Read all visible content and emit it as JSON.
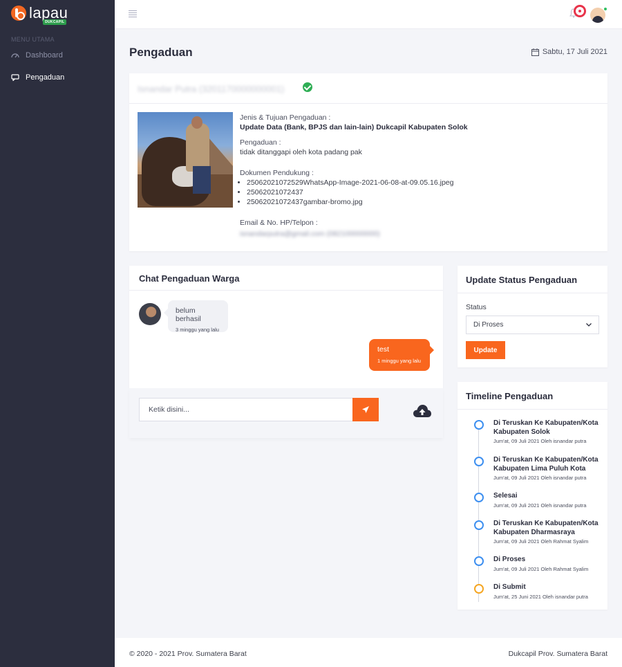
{
  "sidebar": {
    "logo_text": "lapau",
    "logo_tag": "DUKCAPIL",
    "menu_title": "MENU UTAMA",
    "items": [
      {
        "label": "Dashboard",
        "icon": "dashboard-icon"
      },
      {
        "label": "Pengaduan",
        "icon": "chat-icon"
      }
    ]
  },
  "header": {
    "title": "Pengaduan",
    "date": "Sabtu, 17 Juli 2021"
  },
  "complaint": {
    "reporter_blurred": "Isnandar Putra (3201170000000001)",
    "jenis_label": "Jenis & Tujuan Pengaduan :",
    "jenis_value": "Update Data (Bank, BPJS dan lain-lain) Dukcapil Kabupaten Solok",
    "pengaduan_label": "Pengaduan :",
    "pengaduan_value": "tidak ditanggapi oleh kota padang pak",
    "dokumen_label": "Dokumen Pendukung :",
    "documents": [
      "25062021072529WhatsApp-Image-2021-06-08-at-09.05.16.jpeg",
      "25062021072437",
      "25062021072437gambar-bromo.jpg"
    ],
    "contact_label": "Email & No. HP/Telpon :",
    "contact_value_blurred": "isnandarputra@gmail.com (082100000000)"
  },
  "chat": {
    "title": "Chat Pengaduan Warga",
    "messages": [
      {
        "text": "belum berhasil",
        "time": "3 minggu yang lalu",
        "side": "in"
      },
      {
        "text": "test",
        "time": "1 minggu yang lalu",
        "side": "out"
      }
    ],
    "input_placeholder": "Ketik disini..."
  },
  "status": {
    "title": "Update Status Pengaduan",
    "label": "Status",
    "selected": "Di Proses",
    "button": "Update"
  },
  "timeline": {
    "title": "Timeline Pengaduan",
    "items": [
      {
        "title": "Di Teruskan Ke Kabupaten/Kota Kabupaten Solok",
        "meta": "Jum'at, 09 Juli 2021 Oleh isnandar putra",
        "color": "#3d8ff0"
      },
      {
        "title": "Di Teruskan Ke Kabupaten/Kota Kabupaten Lima Puluh Kota",
        "meta": "Jum'at, 09 Juli 2021 Oleh isnandar putra",
        "color": "#3d8ff0"
      },
      {
        "title": "Selesai",
        "meta": "Jum'at, 09 Juli 2021 Oleh isnandar putra",
        "color": "#3d8ff0"
      },
      {
        "title": "Di Teruskan Ke Kabupaten/Kota Kabupaten Dharmasraya",
        "meta": "Jum'at, 09 Juli 2021 Oleh Rahmat Syalim",
        "color": "#3d8ff0"
      },
      {
        "title": "Di Proses",
        "meta": "Jum'at, 09 Juli 2021 Oleh Rahmat Syalim",
        "color": "#3d8ff0"
      },
      {
        "title": "Di Submit",
        "meta": "Jum'at, 25 Juni 2021 Oleh isnandar putra",
        "color": "#f5a623"
      }
    ]
  },
  "footer": {
    "left": "© 2020 - 2021 Prov. Sumatera Barat",
    "right": "Dukcapil Prov. Sumatera Barat"
  },
  "colors": {
    "accent": "#f9661e",
    "sidebar": "#2c2e3e",
    "timeline_blue": "#3d8ff0",
    "timeline_orange": "#f5a623",
    "verified_green": "#2fae55"
  }
}
